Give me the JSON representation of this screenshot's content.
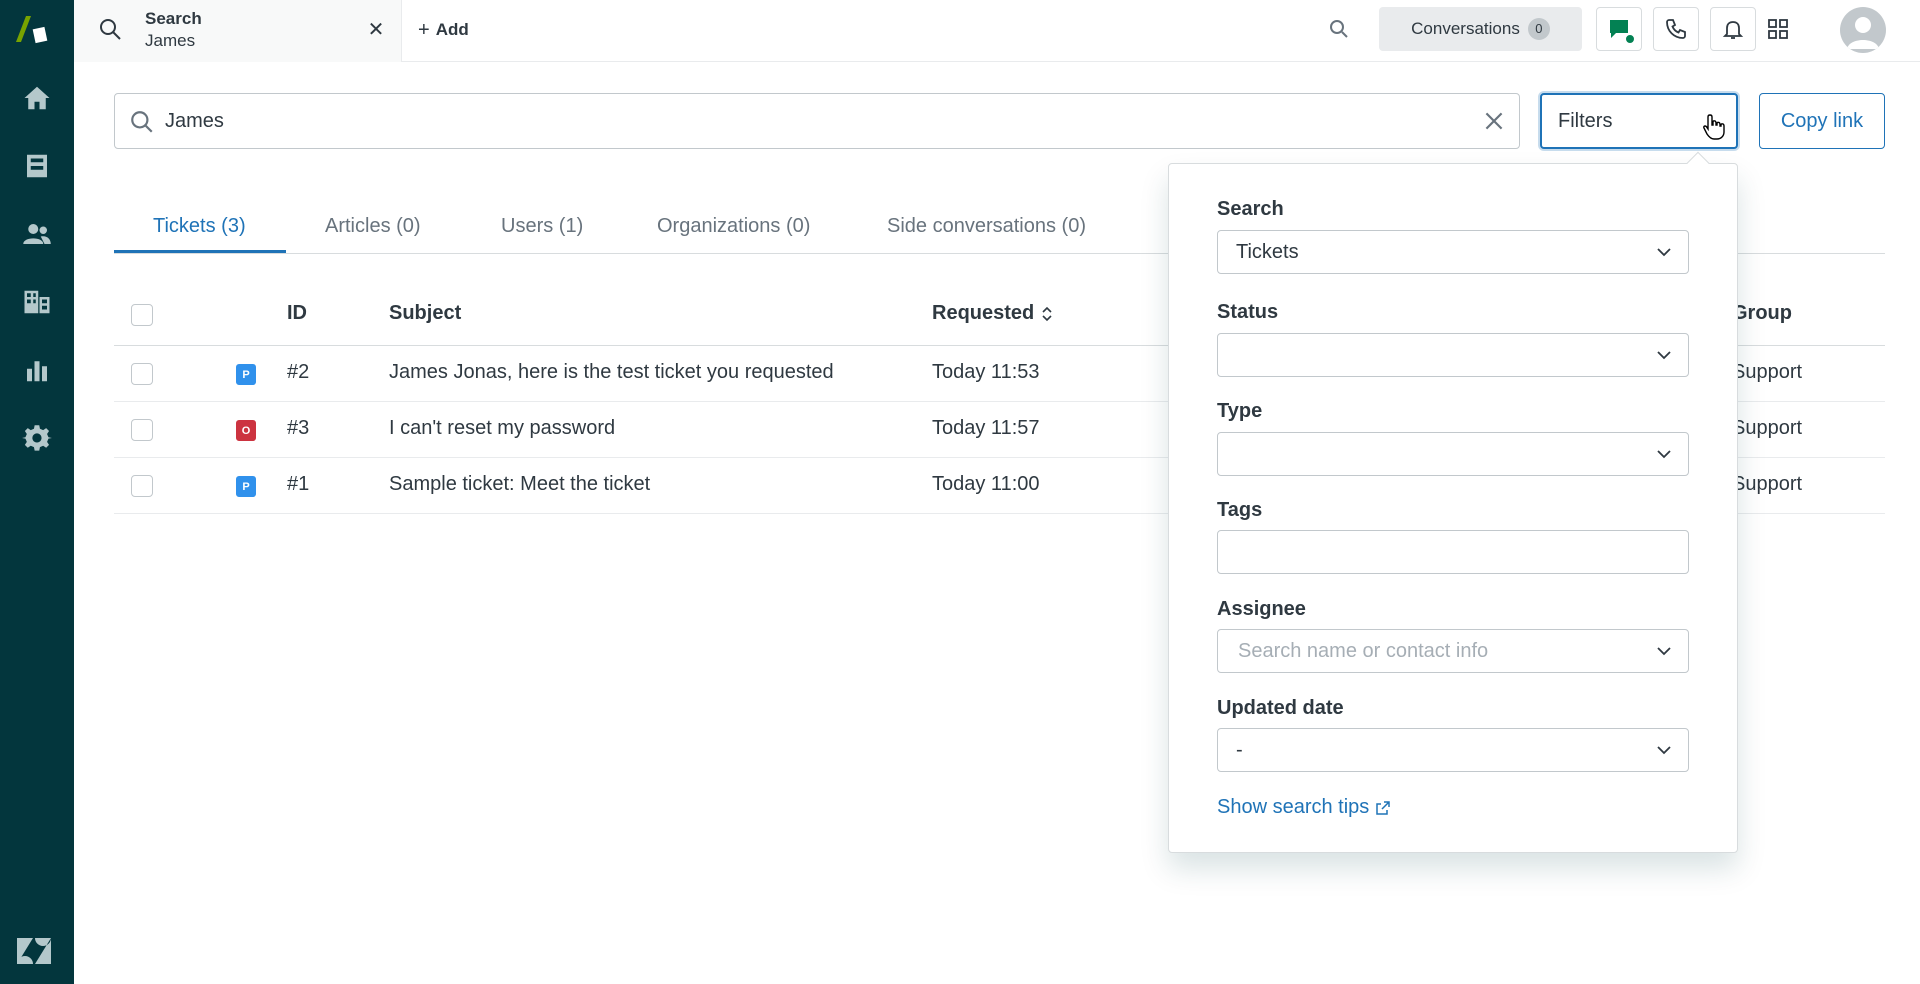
{
  "app": {
    "brand_color": "#03363d",
    "accent_color": "#1f73b7"
  },
  "nav": {
    "items": [
      {
        "name": "home-icon"
      },
      {
        "name": "views-icon"
      },
      {
        "name": "customers-icon"
      },
      {
        "name": "organizations-icon"
      },
      {
        "name": "reporting-icon"
      },
      {
        "name": "admin-gear-icon"
      }
    ]
  },
  "topbar": {
    "tab": {
      "title": "Search",
      "subtitle": "James"
    },
    "add_label": "Add",
    "conversations_label": "Conversations",
    "conversations_count": "0"
  },
  "search": {
    "query": "James",
    "filters_label": "Filters",
    "copy_link_label": "Copy link"
  },
  "result_tabs": [
    {
      "label": "Tickets (3)",
      "active": true
    },
    {
      "label": "Articles (0)",
      "active": false
    },
    {
      "label": "Users (1)",
      "active": false
    },
    {
      "label": "Organizations (0)",
      "active": false
    },
    {
      "label": "Side conversations (0)",
      "active": false
    }
  ],
  "table": {
    "columns": {
      "id": "ID",
      "subject": "Subject",
      "requested": "Requested",
      "group": "Group"
    },
    "rows": [
      {
        "status": "P",
        "status_color": "#3091ec",
        "id": "#2",
        "subject": "James Jonas, here is the test ticket you requested",
        "requested": "Today 11:53",
        "group": "Support"
      },
      {
        "status": "O",
        "status_color": "#cc3340",
        "id": "#3",
        "subject": "I can't reset my password",
        "requested": "Today 11:57",
        "group": "Support"
      },
      {
        "status": "P",
        "status_color": "#3091ec",
        "id": "#1",
        "subject": "Sample ticket: Meet the ticket",
        "requested": "Today 11:00",
        "group": "Support"
      }
    ]
  },
  "filters": {
    "search_label": "Search",
    "search_value": "Tickets",
    "status_label": "Status",
    "status_value": "",
    "type_label": "Type",
    "type_value": "",
    "tags_label": "Tags",
    "tags_value": "",
    "assignee_label": "Assignee",
    "assignee_placeholder": "Search name or contact info",
    "updated_label": "Updated date",
    "updated_value": "-",
    "tips_label": "Show search tips"
  }
}
